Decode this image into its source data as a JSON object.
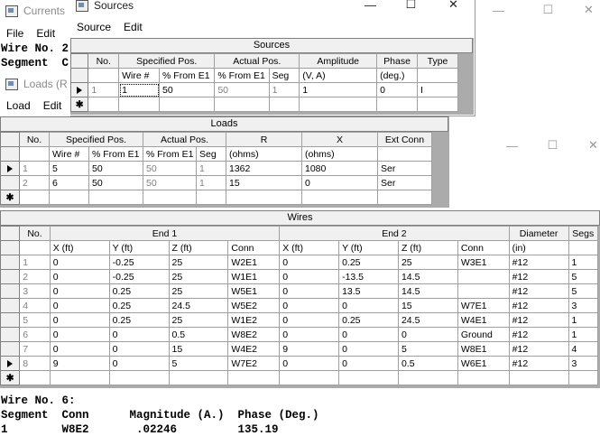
{
  "currents_window": {
    "title": "Currents",
    "menu": [
      "File",
      "Edit"
    ],
    "bg_lines": [
      "Wire No. 2",
      "Segment  C"
    ],
    "footer_lines": [
      "Wire No. 6:",
      "Segment  Conn      Magnitude (A.)  Phase (Deg.)",
      "1        W8E2       .02246         135.19"
    ]
  },
  "loads_window": {
    "title": "Loads (R",
    "menu": [
      "Load",
      "Edit"
    ]
  },
  "sources_window": {
    "title": "Sources",
    "menu": [
      "Source",
      "Edit"
    ]
  },
  "sources": {
    "caption": "Sources",
    "groups": [
      "No.",
      "Specified Pos.",
      "Actual Pos.",
      "Amplitude",
      "Phase",
      "Type"
    ],
    "subheaders": [
      "Wire #",
      "% From E1",
      "% From E1",
      "Seg",
      "(V, A)",
      "(deg.)"
    ],
    "rows": [
      {
        "no": "1",
        "wire": "1",
        "spec_pct": "50",
        "act_pct": "50",
        "seg": "1",
        "amp": "1",
        "phase": "0",
        "type": "I"
      }
    ]
  },
  "loads": {
    "caption": "Loads",
    "groups": [
      "No.",
      "Specified Pos.",
      "Actual Pos.",
      "R",
      "X",
      "Ext Conn"
    ],
    "subheaders": [
      "Wire #",
      "% From E1",
      "% From E1",
      "Seg",
      "(ohms)",
      "(ohms)"
    ],
    "rows": [
      {
        "no": "1",
        "wire": "5",
        "spec_pct": "50",
        "act_pct": "50",
        "seg": "1",
        "r": "1362",
        "x": "1080",
        "ext": "Ser"
      },
      {
        "no": "2",
        "wire": "6",
        "spec_pct": "50",
        "act_pct": "50",
        "seg": "1",
        "r": "15",
        "x": "0",
        "ext": "Ser"
      }
    ]
  },
  "wires": {
    "caption": "Wires",
    "groups": [
      "No.",
      "End 1",
      "End 2",
      "Diameter",
      "Segs"
    ],
    "subheaders": [
      "X  (ft)",
      "Y  (ft)",
      "Z  (ft)",
      "Conn",
      "X  (ft)",
      "Y  (ft)",
      "Z  (ft)",
      "Conn",
      "(in)"
    ],
    "rows": [
      [
        "1",
        "0",
        "-0.25",
        "25",
        "W2E1",
        "0",
        "0.25",
        "25",
        "W3E1",
        "#12",
        "1"
      ],
      [
        "2",
        "0",
        "-0.25",
        "25",
        "W1E1",
        "0",
        "-13.5",
        "14.5",
        "",
        "#12",
        "5"
      ],
      [
        "3",
        "0",
        "0.25",
        "25",
        "W5E1",
        "0",
        "13.5",
        "14.5",
        "",
        "#12",
        "5"
      ],
      [
        "4",
        "0",
        "0.25",
        "24.5",
        "W5E2",
        "0",
        "0",
        "15",
        "W7E1",
        "#12",
        "3"
      ],
      [
        "5",
        "0",
        "0.25",
        "25",
        "W1E2",
        "0",
        "0.25",
        "24.5",
        "W4E1",
        "#12",
        "1"
      ],
      [
        "6",
        "0",
        "0",
        "0.5",
        "W8E2",
        "0",
        "0",
        "0",
        "Ground",
        "#12",
        "1"
      ],
      [
        "7",
        "0",
        "0",
        "15",
        "W4E2",
        "9",
        "0",
        "5",
        "W8E1",
        "#12",
        "4"
      ],
      [
        "8",
        "9",
        "0",
        "5",
        "W7E2",
        "0",
        "0",
        "0.5",
        "W6E1",
        "#12",
        "3"
      ]
    ]
  },
  "window_controls": {
    "minimize": "—",
    "maximize": "☐",
    "close": "✕"
  }
}
